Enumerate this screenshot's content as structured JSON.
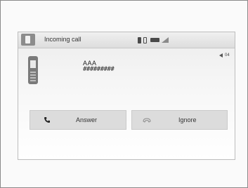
{
  "header": {
    "title": "Incoming call"
  },
  "status": {
    "icons": [
      "bluetooth-icon",
      "phone-icon",
      "battery-icon",
      "signal-icon"
    ]
  },
  "caller": {
    "name": "AAA",
    "number": "#########"
  },
  "volume": {
    "level": "04"
  },
  "buttons": {
    "answer_label": "Answer",
    "ignore_label": "Ignore"
  },
  "colors": {
    "button_bg": "#dcdcdc",
    "icon_dark": "#4a4a4a"
  }
}
